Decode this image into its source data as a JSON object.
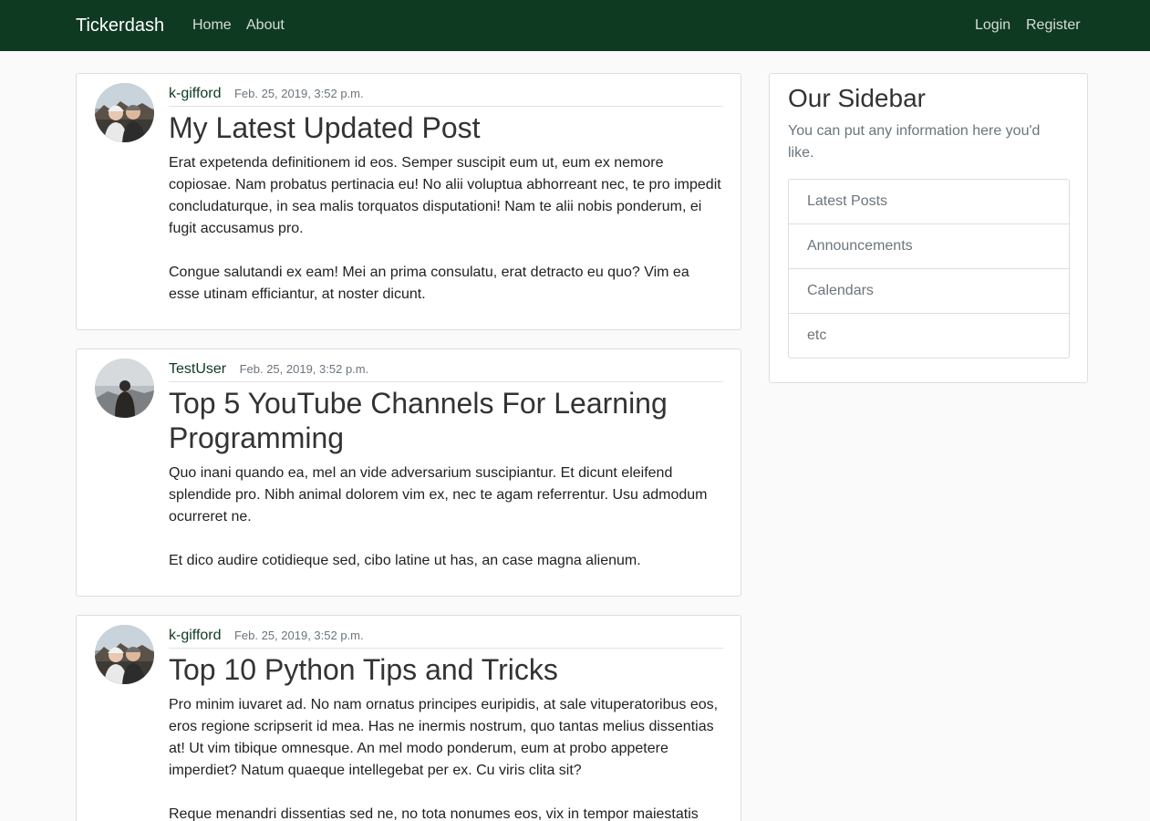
{
  "nav": {
    "brand": "Tickerdash",
    "left": [
      "Home",
      "About"
    ],
    "right": [
      "Login",
      "Register"
    ]
  },
  "posts": [
    {
      "author": "k-gifford",
      "date": "Feb. 25, 2019, 3:52 p.m.",
      "title": "My Latest Updated Post",
      "paragraphs": [
        "Erat expetenda definitionem id eos. Semper suscipit eum ut, eum ex nemore copiosae. Nam probatus pertinacia eu! No alii voluptua abhorreant nec, te pro impedit concludaturque, in sea malis torquatos disputationi! Nam te alii nobis ponderum, ei fugit accusamus pro.",
        "Congue salutandi ex eam! Mei an prima consulatu, erat detracto eu quo? Vim ea esse utinam efficiantur, at noster dicunt."
      ]
    },
    {
      "author": "TestUser",
      "date": "Feb. 25, 2019, 3:52 p.m.",
      "title": "Top 5 YouTube Channels For Learning Programming",
      "paragraphs": [
        "Quo inani quando ea, mel an vide adversarium suscipiantur. Et dicunt eleifend splendide pro. Nibh animal dolorem vim ex, nec te agam referrentur. Usu admodum ocurreret ne.",
        "Et dico audire cotidieque sed, cibo latine ut has, an case magna alienum."
      ]
    },
    {
      "author": "k-gifford",
      "date": "Feb. 25, 2019, 3:52 p.m.",
      "title": "Top 10 Python Tips and Tricks",
      "paragraphs": [
        "Pro minim iuvaret ad. No nam ornatus principes euripidis, at sale vituperatoribus eos, eros regione scripserit id mea. Has ne inermis nostrum, quo tantas melius dissentias at! Ut vim tibique omnesque. An mel modo ponderum, eum at probo appetere imperdiet? Natum quaeque intellegebat per ex. Cu viris clita sit?",
        "Reque menandri dissentias sed ne, no tota nonumes eos, vix in tempor maiestatis"
      ]
    }
  ],
  "sidebar": {
    "title": "Our Sidebar",
    "text": "You can put any information here you'd like.",
    "items": [
      "Latest Posts",
      "Announcements",
      "Calendars",
      "etc"
    ]
  },
  "colors": {
    "navbar": "#0e3a21",
    "author_link": "#0e3a21",
    "muted": "#6c757d"
  },
  "icons": {
    "avatar_couple": "avatar-couple-photo",
    "avatar_person": "avatar-person-silhouette"
  }
}
